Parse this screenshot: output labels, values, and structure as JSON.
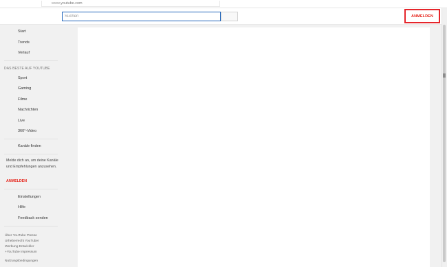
{
  "browser": {
    "url_scheme": "www.",
    "url_host": "youtube.com"
  },
  "header": {
    "search_placeholder": "Suchen",
    "signin_label": "ANMELDEN"
  },
  "sidebar": {
    "main": [
      "Start",
      "Trends",
      "Verlauf"
    ],
    "section_title": "DAS BESTE AUF YOUTUBE",
    "best": [
      "Sport",
      "Gaming",
      "Filme",
      "Nachrichten",
      "Live",
      "360°-Video"
    ],
    "channels": "Kanäle finden",
    "promo_text": "Melde dich an, um deine Kanäle und Empfehlungen anzusehen.",
    "promo_signin": "ANMELDEN",
    "settings": [
      "Einstellungen",
      "Hilfe",
      "Feedback senden"
    ]
  },
  "footer": {
    "links": "Über YouTube  Presse\nUrheberrecht  YouTuber\nWerbung  Entwickler\n+YouTube  Impressum",
    "legal": "Nutzungsbedingungen"
  },
  "colors": {
    "brand_red": "#e62117",
    "highlight_red": "#e5252b",
    "search_focus": "#1c62b9"
  }
}
